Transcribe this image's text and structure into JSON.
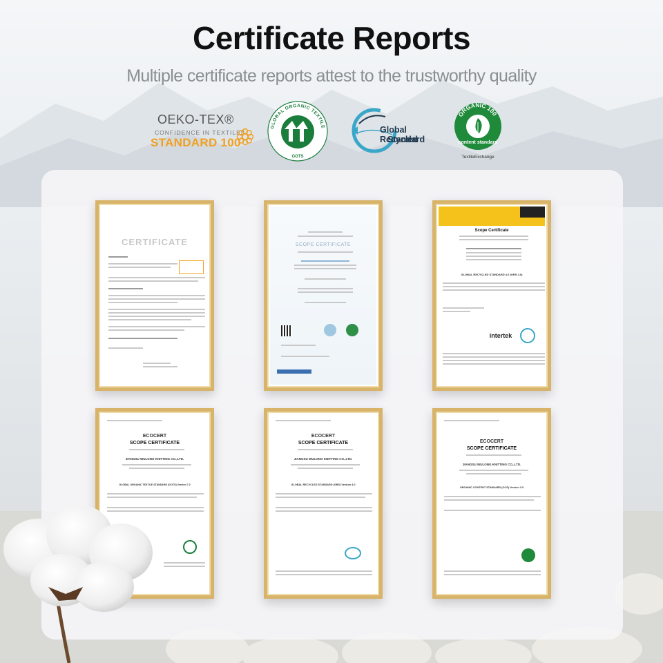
{
  "header": {
    "title": "Certificate Reports",
    "subtitle": "Multiple certificate reports attest to the trustworthy quality"
  },
  "logos": {
    "oeko_tex": {
      "line1": "OEKO-TEX®",
      "line2": "CONFIDENCE IN TEXTILES",
      "line3": "STANDARD 100",
      "accent": "#f0a020"
    },
    "gots": {
      "ring_text": "GLOBAL ORGANIC TEXTILE STANDARD",
      "bottom": "GOTS",
      "color": "#1a7d3c"
    },
    "grs": {
      "line1": "Global Recycled",
      "line2": "Standard",
      "color": "#20394f"
    },
    "ocs": {
      "ring_text": "ORGANIC 100",
      "line1": "content standard",
      "line2": "TextileExchange",
      "color": "#1e8a3a"
    }
  },
  "certificates": [
    {
      "heading": "CERTIFICATE",
      "body": ""
    },
    {
      "heading": "SCOPE CERTIFICATE",
      "body": ""
    },
    {
      "heading": "Scope Certificate",
      "body": "GLOBAL RECYCLED STANDARD 4.0 (GRS 4.0)",
      "brand": "intertek"
    },
    {
      "heading": "SCOPE CERTIFICATE",
      "brand": "ECOCERT",
      "company": "JIANGSU WULONG KNITTING CO.,LTD.",
      "body": "GLOBAL ORGANIC TEXTILE STANDARD (GOTS) Version 7.0"
    },
    {
      "heading": "SCOPE CERTIFICATE",
      "brand": "ECOCERT",
      "company": "JIANGSU WULONG KNITTING CO.,LTD.",
      "body": "GLOBAL RECYCLED STANDARD (GRS) Version 4.0"
    },
    {
      "heading": "SCOPE CERTIFICATE",
      "brand": "ECOCERT",
      "company": "JIANGSU WULONG KNITTING CO.,LTD.",
      "body": "ORGANIC CONTENT STANDARD (OCS) Version 3.0"
    }
  ]
}
